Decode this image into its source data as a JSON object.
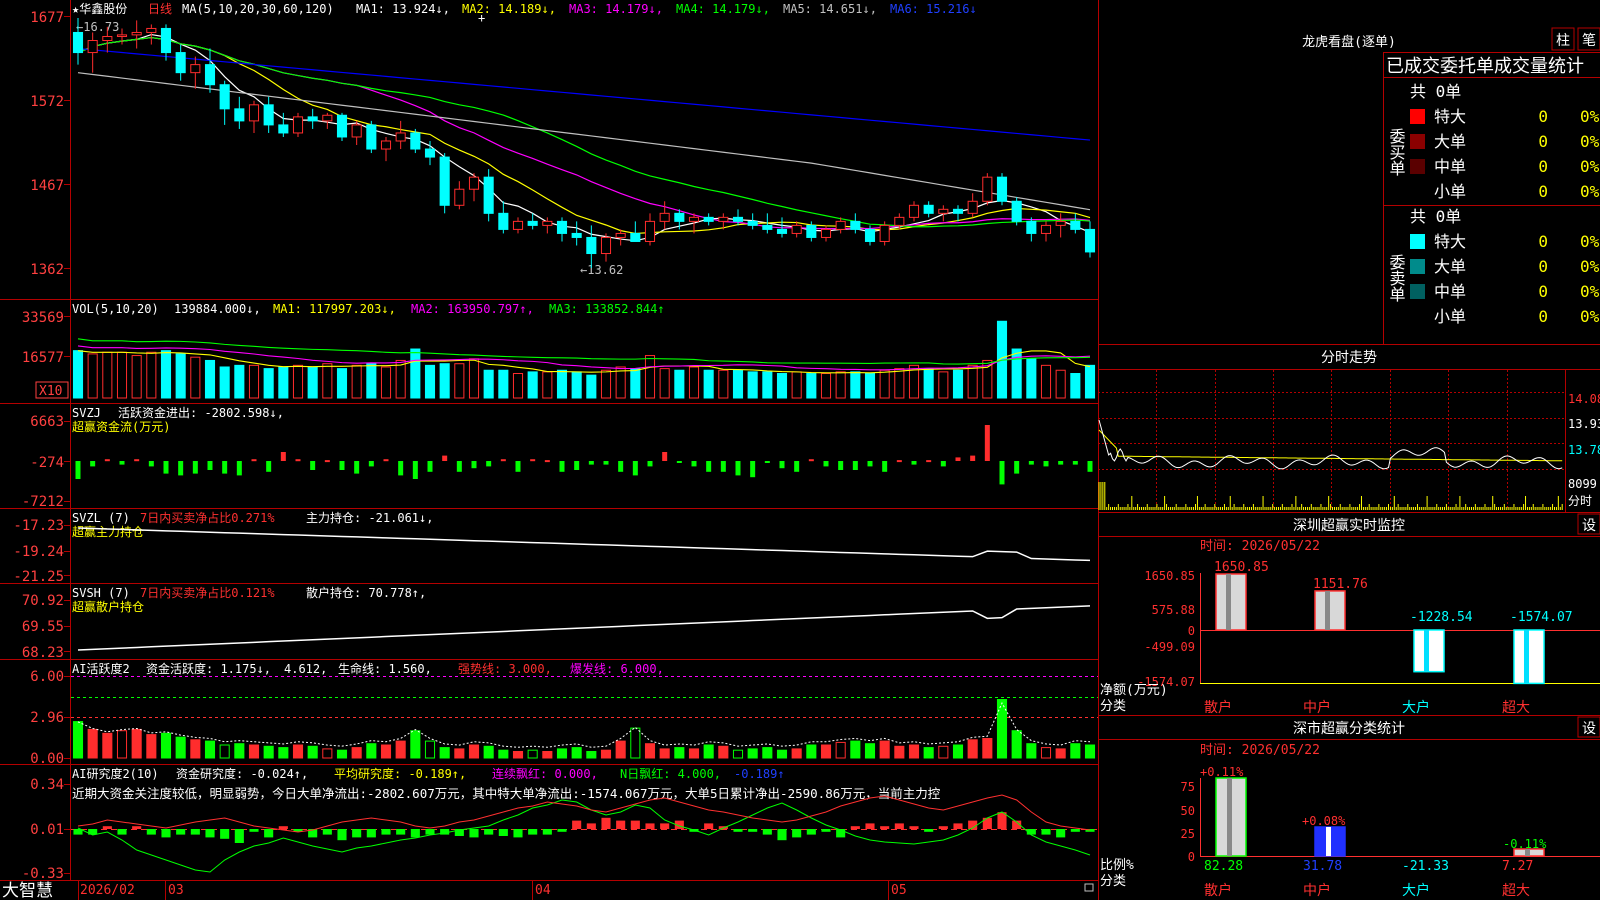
{
  "colors": {
    "up": "#ff2d2d",
    "down": "#00ffff",
    "frame": "#b40000",
    "axis_text": "#ff4040",
    "ma1": "#ffffff",
    "ma2": "#ffff00",
    "ma3": "#ff00ff",
    "ma4": "#00ff00",
    "ma5": "#c0c0c0",
    "ma6": "#0000ff"
  },
  "header": {
    "stock": "★华鑫股份",
    "period": "日线",
    "ma_params": "MA(5,10,20,30,60,120)",
    "ma1": "MA1: 13.924↓,",
    "ma2": "MA2: 14.189↓,",
    "ma3": "MA3: 14.179↓,",
    "ma4": "MA4: 14.179↓,",
    "ma5": "MA5: 14.651↓,",
    "ma6": "MA6: 15.216↓",
    "hi_label": "←16.73",
    "lo_label": "←13.62"
  },
  "price_axis": [
    "1677",
    "1572",
    "1467",
    "1362"
  ],
  "vol_panel": {
    "t0": "VOL(5,10,20)",
    "t1": "139884.000↓,",
    "t2": "MA1: 117997.203↓,",
    "t3": "MA2: 163950.797↑,",
    "t4": "MA3: 133852.844↑",
    "axis": [
      "33569",
      "16577"
    ],
    "unit": "X10"
  },
  "svzj_panel": {
    "l1a": "SVZJ",
    "l1b": "活跃资金进出: -2802.598↓,",
    "l2": "超赢资金流(万元)",
    "axis": [
      "6663",
      "-274",
      "-7212"
    ]
  },
  "svzl_panel": {
    "a": "SVZL (7)",
    "b": "7日内买卖净占比0.271%",
    "c": "主力持仓: -21.061↓,",
    "l2": "超赢主力持仓",
    "axis": [
      "-17.23",
      "-19.24",
      "-21.25"
    ]
  },
  "svsh_panel": {
    "a": "SVSH (7)",
    "b": "7日内买卖净占比0.121%",
    "c": "散户持仓: 70.778↑,",
    "l2": "超赢散户持仓",
    "axis": [
      "70.92",
      "69.55",
      "68.23"
    ]
  },
  "ai1_panel": {
    "a": "AI活跃度2",
    "b": "资金活跃度: 1.175↓,",
    "c": "4.612,",
    "d": "生命线: 1.560,",
    "e": "强势线: 3.000,",
    "f": "爆发线: 6.000,",
    "axis": [
      "6.00",
      "2.96",
      "0.00"
    ]
  },
  "ai2_panel": {
    "a": "AI研究度2(10)",
    "b": "资金研究度: -0.024↑,",
    "c": "平均研究度: -0.189↑,",
    "d": "连续飘红: 0.000,",
    "e": "N日飘红: 4.000,",
    "f": "-0.189↑",
    "note": "近期大资金关注度较低，明显弱势，今日大单净流出:-2802.607万元，其中特大单净流出:-1574.067万元，大单5日累计净出-2590.86万元，当前主力控",
    "axis": [
      "0.34",
      "0.01",
      "-0.33"
    ]
  },
  "bottom_bar": {
    "brand": "大智慧",
    "d1": "2026/02",
    "d2": "03",
    "d3": "04",
    "d4": "05"
  },
  "dragon_tiger": {
    "title": "龙虎看盘(逐单)",
    "btn1": "柱",
    "btn2": "笔",
    "stat_title": "已成交委托单成交量统计",
    "buy_label": "委买单",
    "sell_label": "委卖单",
    "buy_total": "共 0单",
    "sell_total": "共 0单",
    "rows": [
      {
        "name": "特大",
        "count": "0",
        "pct": "0%"
      },
      {
        "name": "大单",
        "count": "0",
        "pct": "0%"
      },
      {
        "name": "中单",
        "count": "0",
        "pct": "0%"
      },
      {
        "name": "小单",
        "count": "0",
        "pct": "0%"
      }
    ]
  },
  "minute_chart": {
    "title": "分时走势",
    "p1": "14.08",
    "p2": "13.93",
    "p3": "13.78",
    "vol": "8099",
    "unit": "分时"
  },
  "monitor": {
    "title": "深圳超赢实时监控",
    "btn": "设",
    "time": "时间: 2026/05/22",
    "axis": [
      "1650.85",
      "575.88",
      "0",
      "-499.09",
      "-1574.07"
    ],
    "ylabel": "净额(万元)",
    "xlabel": "分类",
    "categories": [
      "散户",
      "中户",
      "大户",
      "超大"
    ],
    "value_labels": [
      "1650.85",
      "1151.76",
      "-1228.54",
      "-1574.07"
    ]
  },
  "classify": {
    "title": "深市超赢分类统计",
    "btn": "设",
    "time": "时间: 2026/05/22",
    "axis": [
      "75",
      "50",
      "25",
      "0"
    ],
    "ylabel": "比例%",
    "xlabel": "分类",
    "top_labels": [
      "+0.11%",
      "+0.08%",
      "-0.11%"
    ],
    "values": [
      "82.28",
      "31.78",
      "-21.33",
      "7.27"
    ],
    "categories": [
      "散户",
      "中户",
      "大户",
      "超大"
    ]
  },
  "chart_data": [
    {
      "type": "candlestick",
      "title": "华鑫股份 日线",
      "x": [
        "2026/02",
        "03",
        "04",
        "05"
      ],
      "ylim": [
        13.62,
        16.73
      ],
      "ohlc": [
        [
          16.55,
          16.73,
          16.15,
          16.3
        ],
        [
          16.3,
          16.55,
          16.05,
          16.45
        ],
        [
          16.45,
          16.62,
          16.3,
          16.5
        ],
        [
          16.5,
          16.6,
          16.4,
          16.52
        ],
        [
          16.52,
          16.7,
          16.35,
          16.55
        ],
        [
          16.55,
          16.65,
          16.4,
          16.6
        ],
        [
          16.6,
          16.65,
          16.2,
          16.3
        ],
        [
          16.3,
          16.4,
          15.95,
          16.05
        ],
        [
          16.05,
          16.25,
          15.85,
          16.15
        ],
        [
          16.15,
          16.35,
          15.8,
          15.9
        ],
        [
          15.9,
          15.95,
          15.4,
          15.6
        ],
        [
          15.6,
          15.75,
          15.35,
          15.45
        ],
        [
          15.45,
          15.7,
          15.3,
          15.65
        ],
        [
          15.65,
          15.75,
          15.3,
          15.4
        ],
        [
          15.4,
          15.55,
          15.25,
          15.3
        ],
        [
          15.3,
          15.55,
          15.25,
          15.5
        ],
        [
          15.5,
          15.6,
          15.35,
          15.45
        ],
        [
          15.45,
          15.55,
          15.35,
          15.52
        ],
        [
          15.52,
          15.55,
          15.2,
          15.25
        ],
        [
          15.25,
          15.45,
          15.15,
          15.4
        ],
        [
          15.4,
          15.45,
          15.05,
          15.1
        ],
        [
          15.1,
          15.25,
          14.95,
          15.2
        ],
        [
          15.2,
          15.45,
          15.1,
          15.3
        ],
        [
          15.3,
          15.35,
          15.05,
          15.1
        ],
        [
          15.1,
          15.2,
          14.9,
          15.0
        ],
        [
          15.0,
          15.05,
          14.3,
          14.4
        ],
        [
          14.4,
          14.7,
          14.35,
          14.6
        ],
        [
          14.6,
          14.8,
          14.45,
          14.75
        ],
        [
          14.75,
          14.85,
          14.2,
          14.3
        ],
        [
          14.3,
          14.45,
          14.05,
          14.1
        ],
        [
          14.1,
          14.25,
          14.05,
          14.2
        ],
        [
          14.2,
          14.3,
          14.1,
          14.15
        ],
        [
          14.15,
          14.25,
          14.05,
          14.2
        ],
        [
          14.2,
          14.25,
          13.95,
          14.05
        ],
        [
          14.05,
          14.2,
          13.9,
          14.0
        ],
        [
          14.0,
          14.15,
          13.62,
          13.8
        ],
        [
          13.8,
          14.05,
          13.7,
          14.0
        ],
        [
          14.0,
          14.1,
          13.9,
          14.05
        ],
        [
          14.05,
          14.2,
          13.95,
          13.95
        ],
        [
          13.95,
          14.3,
          13.9,
          14.2
        ],
        [
          14.2,
          14.45,
          14.1,
          14.3
        ],
        [
          14.3,
          14.35,
          14.1,
          14.2
        ],
        [
          14.2,
          14.3,
          14.05,
          14.25
        ],
        [
          14.25,
          14.3,
          14.15,
          14.2
        ],
        [
          14.2,
          14.3,
          14.1,
          14.25
        ],
        [
          14.25,
          14.35,
          14.15,
          14.2
        ],
        [
          14.2,
          14.3,
          14.1,
          14.15
        ],
        [
          14.15,
          14.3,
          14.05,
          14.1
        ],
        [
          14.1,
          14.25,
          14.0,
          14.05
        ],
        [
          14.05,
          14.2,
          14.0,
          14.15
        ],
        [
          14.15,
          14.2,
          13.95,
          14.0
        ],
        [
          14.0,
          14.15,
          13.95,
          14.1
        ],
        [
          14.1,
          14.25,
          14.05,
          14.2
        ],
        [
          14.2,
          14.3,
          14.05,
          14.1
        ],
        [
          14.1,
          14.15,
          13.9,
          13.95
        ],
        [
          13.95,
          14.2,
          13.9,
          14.15
        ],
        [
          14.15,
          14.3,
          14.1,
          14.25
        ],
        [
          14.25,
          14.45,
          14.2,
          14.4
        ],
        [
          14.4,
          14.45,
          14.25,
          14.3
        ],
        [
          14.3,
          14.4,
          14.2,
          14.35
        ],
        [
          14.35,
          14.4,
          14.2,
          14.3
        ],
        [
          14.3,
          14.55,
          14.25,
          14.45
        ],
        [
          14.45,
          14.8,
          14.4,
          14.75
        ],
        [
          14.75,
          14.8,
          14.4,
          14.45
        ],
        [
          14.45,
          14.5,
          14.15,
          14.2
        ],
        [
          14.2,
          14.25,
          13.95,
          14.05
        ],
        [
          14.05,
          14.2,
          13.95,
          14.15
        ],
        [
          14.15,
          14.3,
          14.0,
          14.2
        ],
        [
          14.2,
          14.3,
          14.05,
          14.1
        ],
        [
          14.1,
          14.2,
          13.75,
          13.82
        ]
      ]
    },
    {
      "type": "bar",
      "title": "VOL(5,10,20)",
      "values": [
        1.45,
        1.35,
        1.4,
        1.4,
        1.3,
        1.4,
        1.45,
        1.35,
        1.25,
        1.15,
        0.95,
        1.0,
        1.0,
        0.9,
        0.95,
        1.0,
        0.95,
        1.05,
        0.9,
        1.0,
        1.05,
        0.95,
        1.15,
        1.5,
        1.0,
        1.05,
        1.05,
        1.2,
        0.85,
        0.85,
        0.75,
        0.8,
        0.8,
        0.85,
        0.8,
        0.7,
        0.85,
        0.95,
        0.9,
        1.3,
        0.9,
        0.85,
        0.95,
        0.85,
        0.85,
        0.85,
        0.8,
        0.8,
        0.75,
        0.8,
        0.75,
        0.75,
        0.8,
        0.8,
        0.75,
        0.85,
        0.9,
        1.0,
        0.9,
        0.8,
        0.85,
        1.0,
        1.15,
        2.35,
        1.5,
        1.2,
        1.0,
        0.85,
        0.75,
        1.0
      ]
    }
  ]
}
